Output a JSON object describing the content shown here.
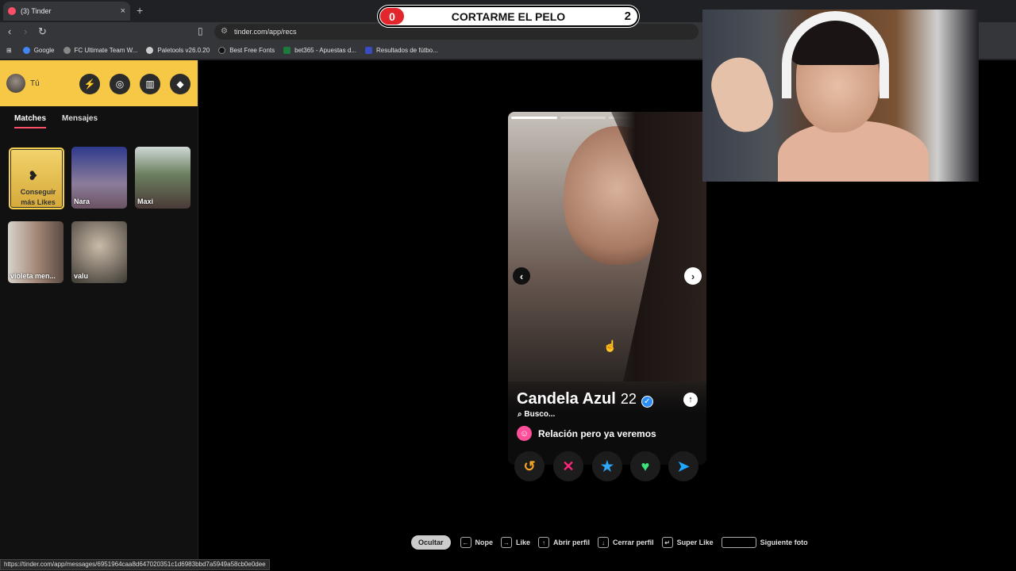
{
  "browser": {
    "tab_title": "(3) Tinder",
    "tab_close": "×",
    "new_tab": "+",
    "url": "tinder.com/app/recs",
    "bookmarks": [
      {
        "label": "Google",
        "color": "#4285f4"
      },
      {
        "label": "FC Ultimate Team W...",
        "color": "#888888"
      },
      {
        "label": "Paletools v26.0.20",
        "color": "#cccccc"
      },
      {
        "label": "Best Free Fonts",
        "color": "#111111"
      },
      {
        "label": "bet365 - Apuestas d...",
        "color": "#1b7a3c"
      },
      {
        "label": "Resultados de fútbo...",
        "color": "#3b4cc0"
      }
    ],
    "status_url": "https://tinder.com/app/messages/6951964caa8d647020351c1d6983bbd7a5949a58cb0e0dee"
  },
  "overlay": {
    "left_count": "0",
    "label": "CORTARME EL PELO",
    "right_count": "2"
  },
  "sidebar": {
    "user_label": "Tú",
    "tabs": {
      "matches": "Matches",
      "messages": "Mensajes"
    },
    "get_likes": "Conseguir más Likes",
    "matches": [
      {
        "name": "Nara"
      },
      {
        "name": "Maxi"
      },
      {
        "name": "violeta men..."
      },
      {
        "name": "valu"
      }
    ]
  },
  "profile": {
    "name": "Candela Azul",
    "age": "22",
    "looking_label": "Busco...",
    "relationship": "Relación pero ya veremos"
  },
  "hints": {
    "hide": "Ocultar",
    "nope": "Nope",
    "like": "Like",
    "open_profile": "Abrir perfil",
    "close_profile": "Cerrar perfil",
    "super_like": "Super Like",
    "next_photo": "Siguiente foto"
  },
  "colors": {
    "tinder_gold": "#f7c846",
    "nope": "#fd267a",
    "like": "#3be27a",
    "super_like": "#2ea7f7",
    "rewind": "#f5a623"
  }
}
